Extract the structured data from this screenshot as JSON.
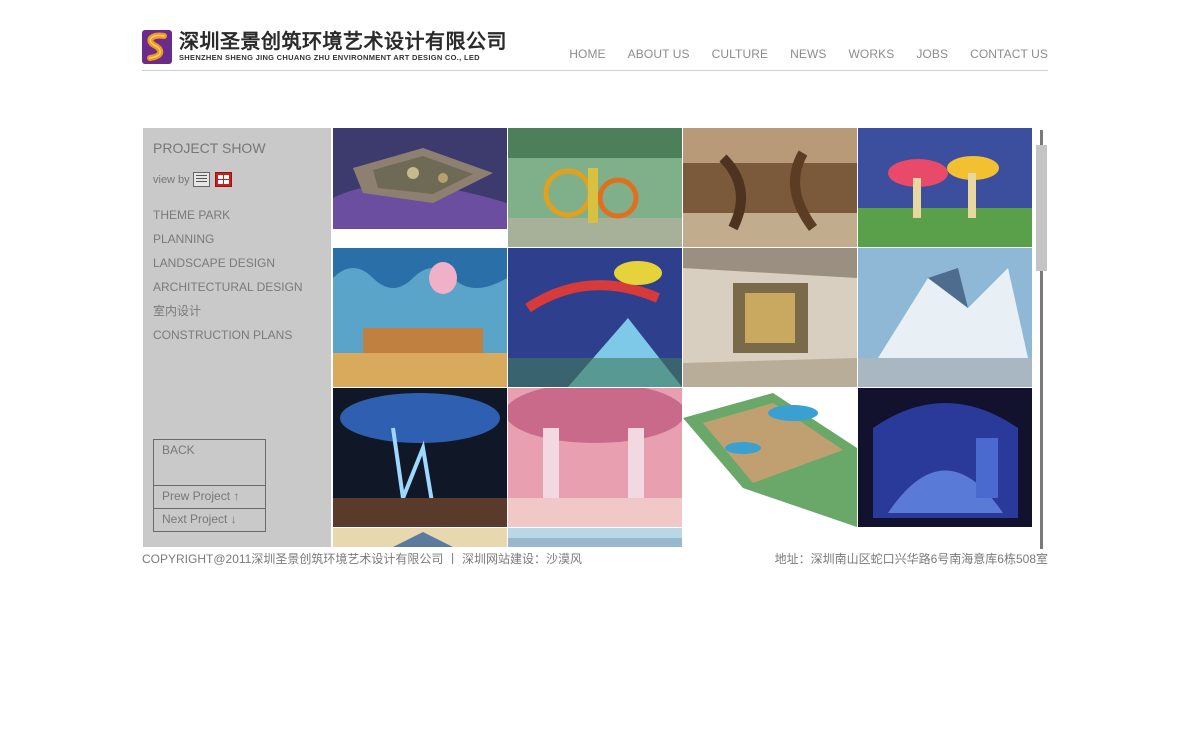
{
  "header": {
    "logo_cn": "深圳圣景创筑环境艺术设计有限公司",
    "logo_en": "SHENZHEN SHENG JING CHUANG ZHU ENVIRONMENT ART DESIGN CO., LED",
    "nav": [
      "HOME",
      "ABOUT US",
      "CULTURE",
      "NEWS",
      "WORKS",
      "JOBS",
      "CONTACT US"
    ]
  },
  "sidebar": {
    "title": "PROJECT SHOW",
    "view_by": "view by",
    "categories": [
      "THEME PARK",
      "PLANNING",
      "LANDSCAPE DESIGN",
      "ARCHITECTURAL DESIGN",
      "室内设计",
      "CONSTRUCTION PLANS"
    ],
    "back": "BACK",
    "prev": "Prew Project ↑",
    "next": "Next  Project ↓"
  },
  "footer": {
    "copyright": "COPYRIGHT@2011深圳圣景创筑环境艺术设计有限公司  丨  深圳网站建设：沙漠风",
    "address": "地址：深圳南山区蛇口兴华路6号南海意库6栋508室"
  },
  "colors": {
    "sidebar_bg": "#c9c9c9",
    "text_gray": "#7a7a7a",
    "logo_orange": "#f29a1f",
    "logo_purple": "#6a2c8a",
    "grid_icon_red": "#c81e1e"
  },
  "icons": [
    "list-view-icon",
    "grid-view-icon",
    "logo-s-icon"
  ]
}
